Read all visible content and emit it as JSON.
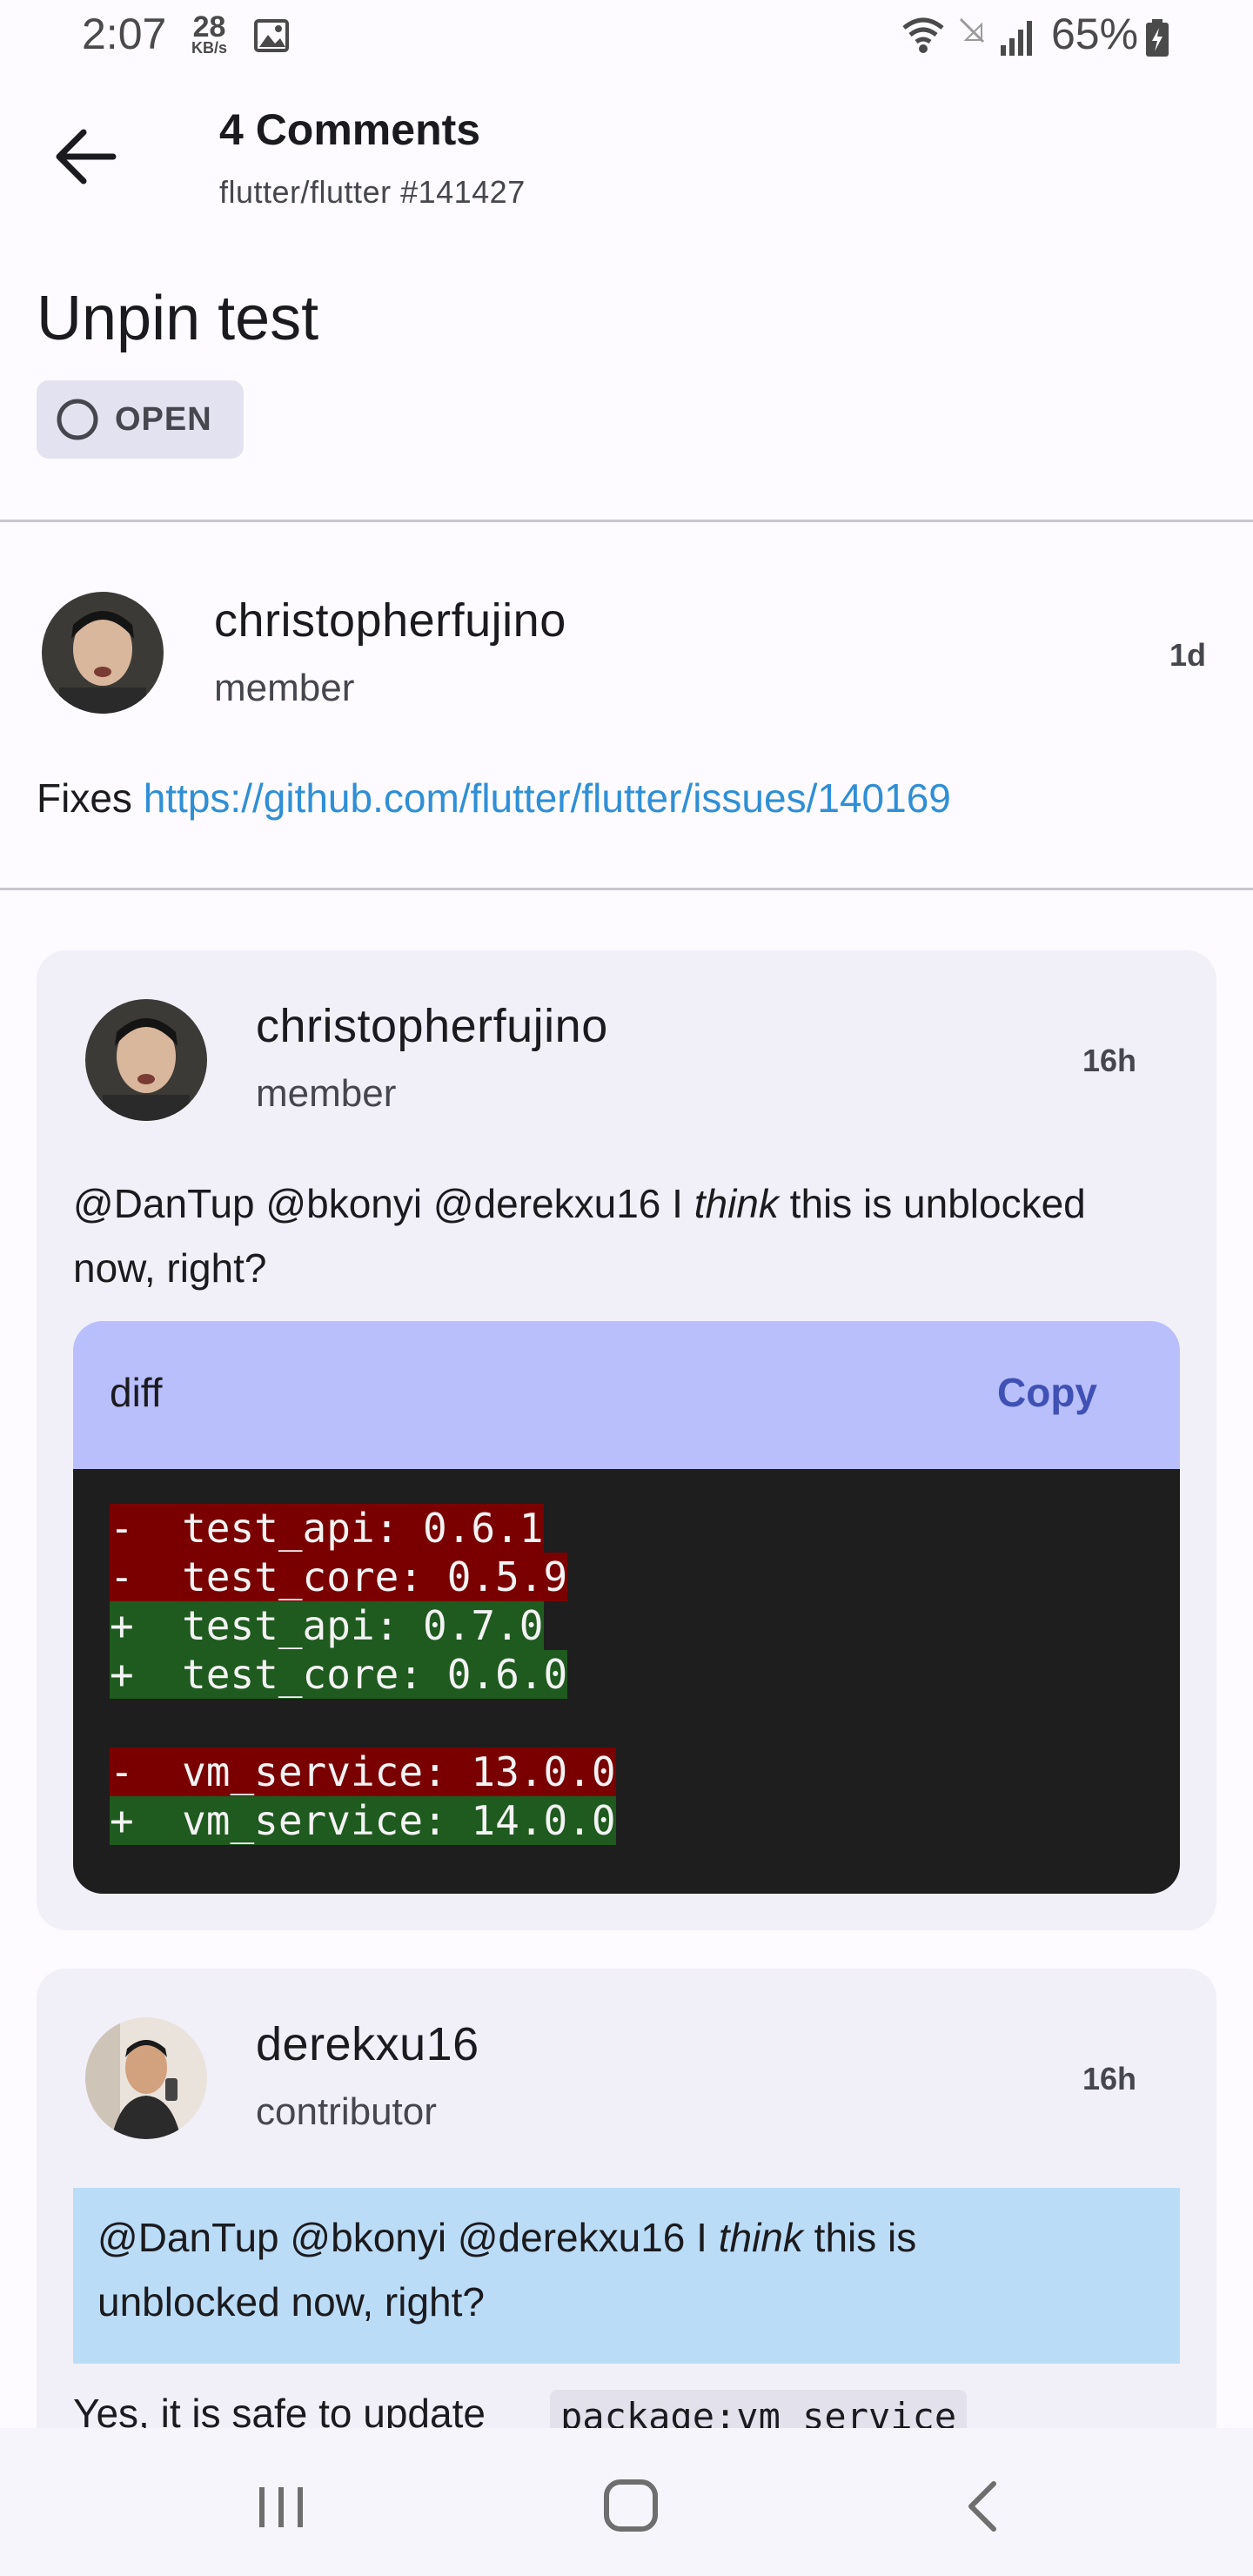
{
  "status_bar": {
    "time": "2:07",
    "net_speed_value": "28",
    "net_speed_unit": "KB/s",
    "battery_percent": "65%"
  },
  "app_bar": {
    "title": "4 Comments",
    "subtitle": "flutter/flutter #141427"
  },
  "issue": {
    "title": "Unpin test",
    "state": "OPEN"
  },
  "opening_post": {
    "author": "christopherfujino",
    "role": "member",
    "age": "1d",
    "body_prefix": "Fixes ",
    "link": "https://github.com/flutter/flutter/issues/140169"
  },
  "comments": [
    {
      "author": "christopherfujino",
      "role": "member",
      "age": "16h",
      "body_before": "@DanTup @bkonyi @derekxu16 I ",
      "body_emph": "think",
      "body_after": " this is unblocked",
      "body_line2": "now, right?",
      "code": {
        "lang": "diff",
        "copy_label": "Copy",
        "lines": [
          "-  test_api: 0.6.1",
          "-  test_core: 0.5.9",
          "+  test_api: 0.7.0",
          "+  test_core: 0.6.0",
          "",
          "-  vm_service: 13.0.0",
          "+  vm_service: 14.0.0"
        ]
      }
    },
    {
      "author": "derekxu16",
      "role": "contributor",
      "age": "16h",
      "quote_before": "@DanTup @bkonyi @derekxu16 I ",
      "quote_emph": "think",
      "quote_after": " this is",
      "quote_line2": "unblocked now, right?",
      "body_before": "Yes, it is safe to update ",
      "body_code": "package:vm_service"
    }
  ],
  "icons": {
    "back": "arrow-back-icon",
    "state": "circle-open-icon",
    "nav_recent": "recent-apps-icon",
    "nav_home": "home-icon",
    "nav_back": "nav-back-icon"
  },
  "colors": {
    "link": "#2f8fd6",
    "code_header": "#b9bffb",
    "copy": "#3f51b5",
    "diff_removed": "#7a0000",
    "diff_added": "#1f5a1f",
    "quote_bg": "#bbdcf7",
    "card_bg": "#f1f0f9"
  }
}
